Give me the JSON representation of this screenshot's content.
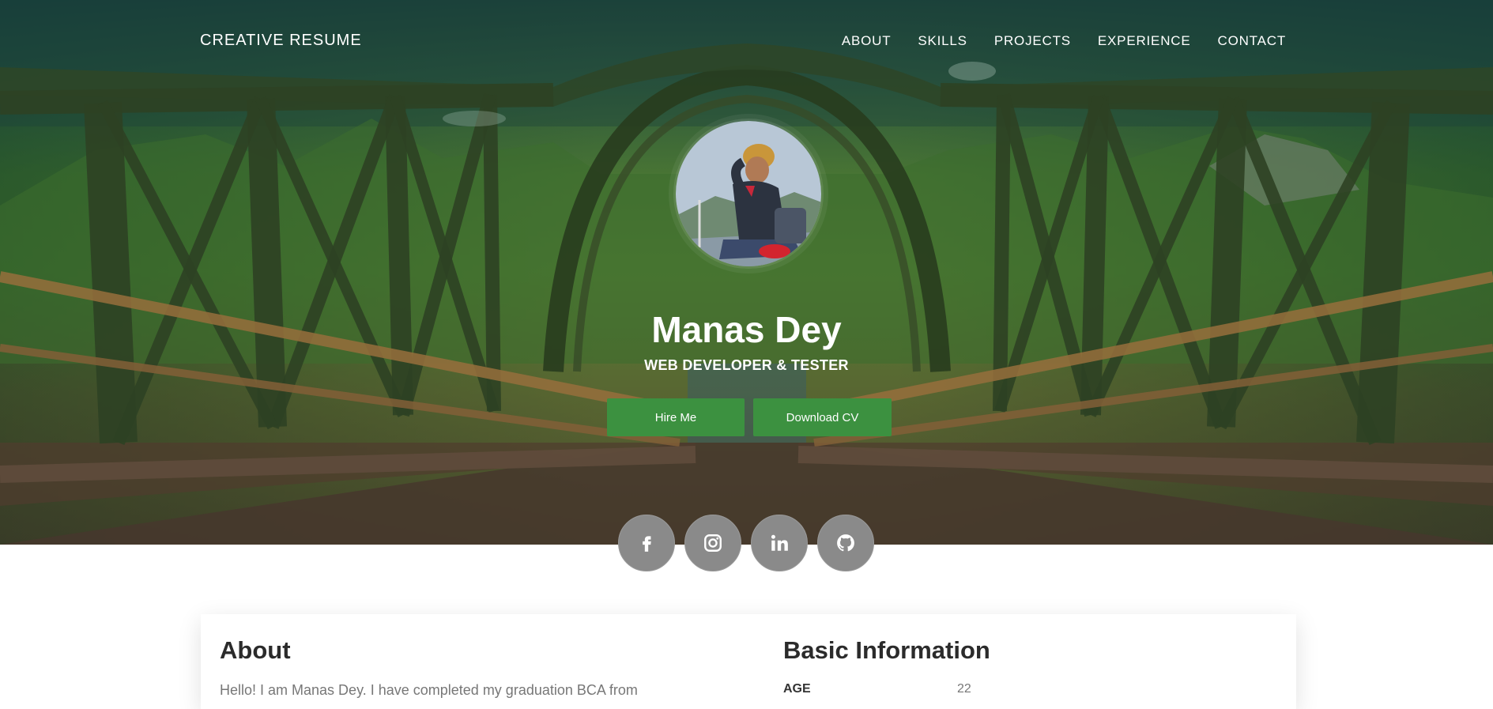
{
  "header": {
    "brand": "CREATIVE RESUME",
    "nav": [
      "ABOUT",
      "SKILLS",
      "PROJECTS",
      "EXPERIENCE",
      "CONTACT"
    ]
  },
  "hero": {
    "name": "Manas Dey",
    "role": "WEB DEVELOPER & TESTER",
    "buttons": {
      "hire": "Hire Me",
      "cv": "Download CV"
    },
    "social": [
      "facebook-icon",
      "instagram-icon",
      "linkedin-icon",
      "github-icon"
    ]
  },
  "about": {
    "heading": "About",
    "text": "Hello! I am Manas Dey. I have completed my graduation BCA from"
  },
  "basic_info": {
    "heading": "Basic Information",
    "rows": [
      {
        "label": "AGE",
        "value": "22"
      }
    ]
  },
  "colors": {
    "accent": "#3c9140",
    "social_bg": "#8a8a8a",
    "heading": "#2b2b2b"
  }
}
